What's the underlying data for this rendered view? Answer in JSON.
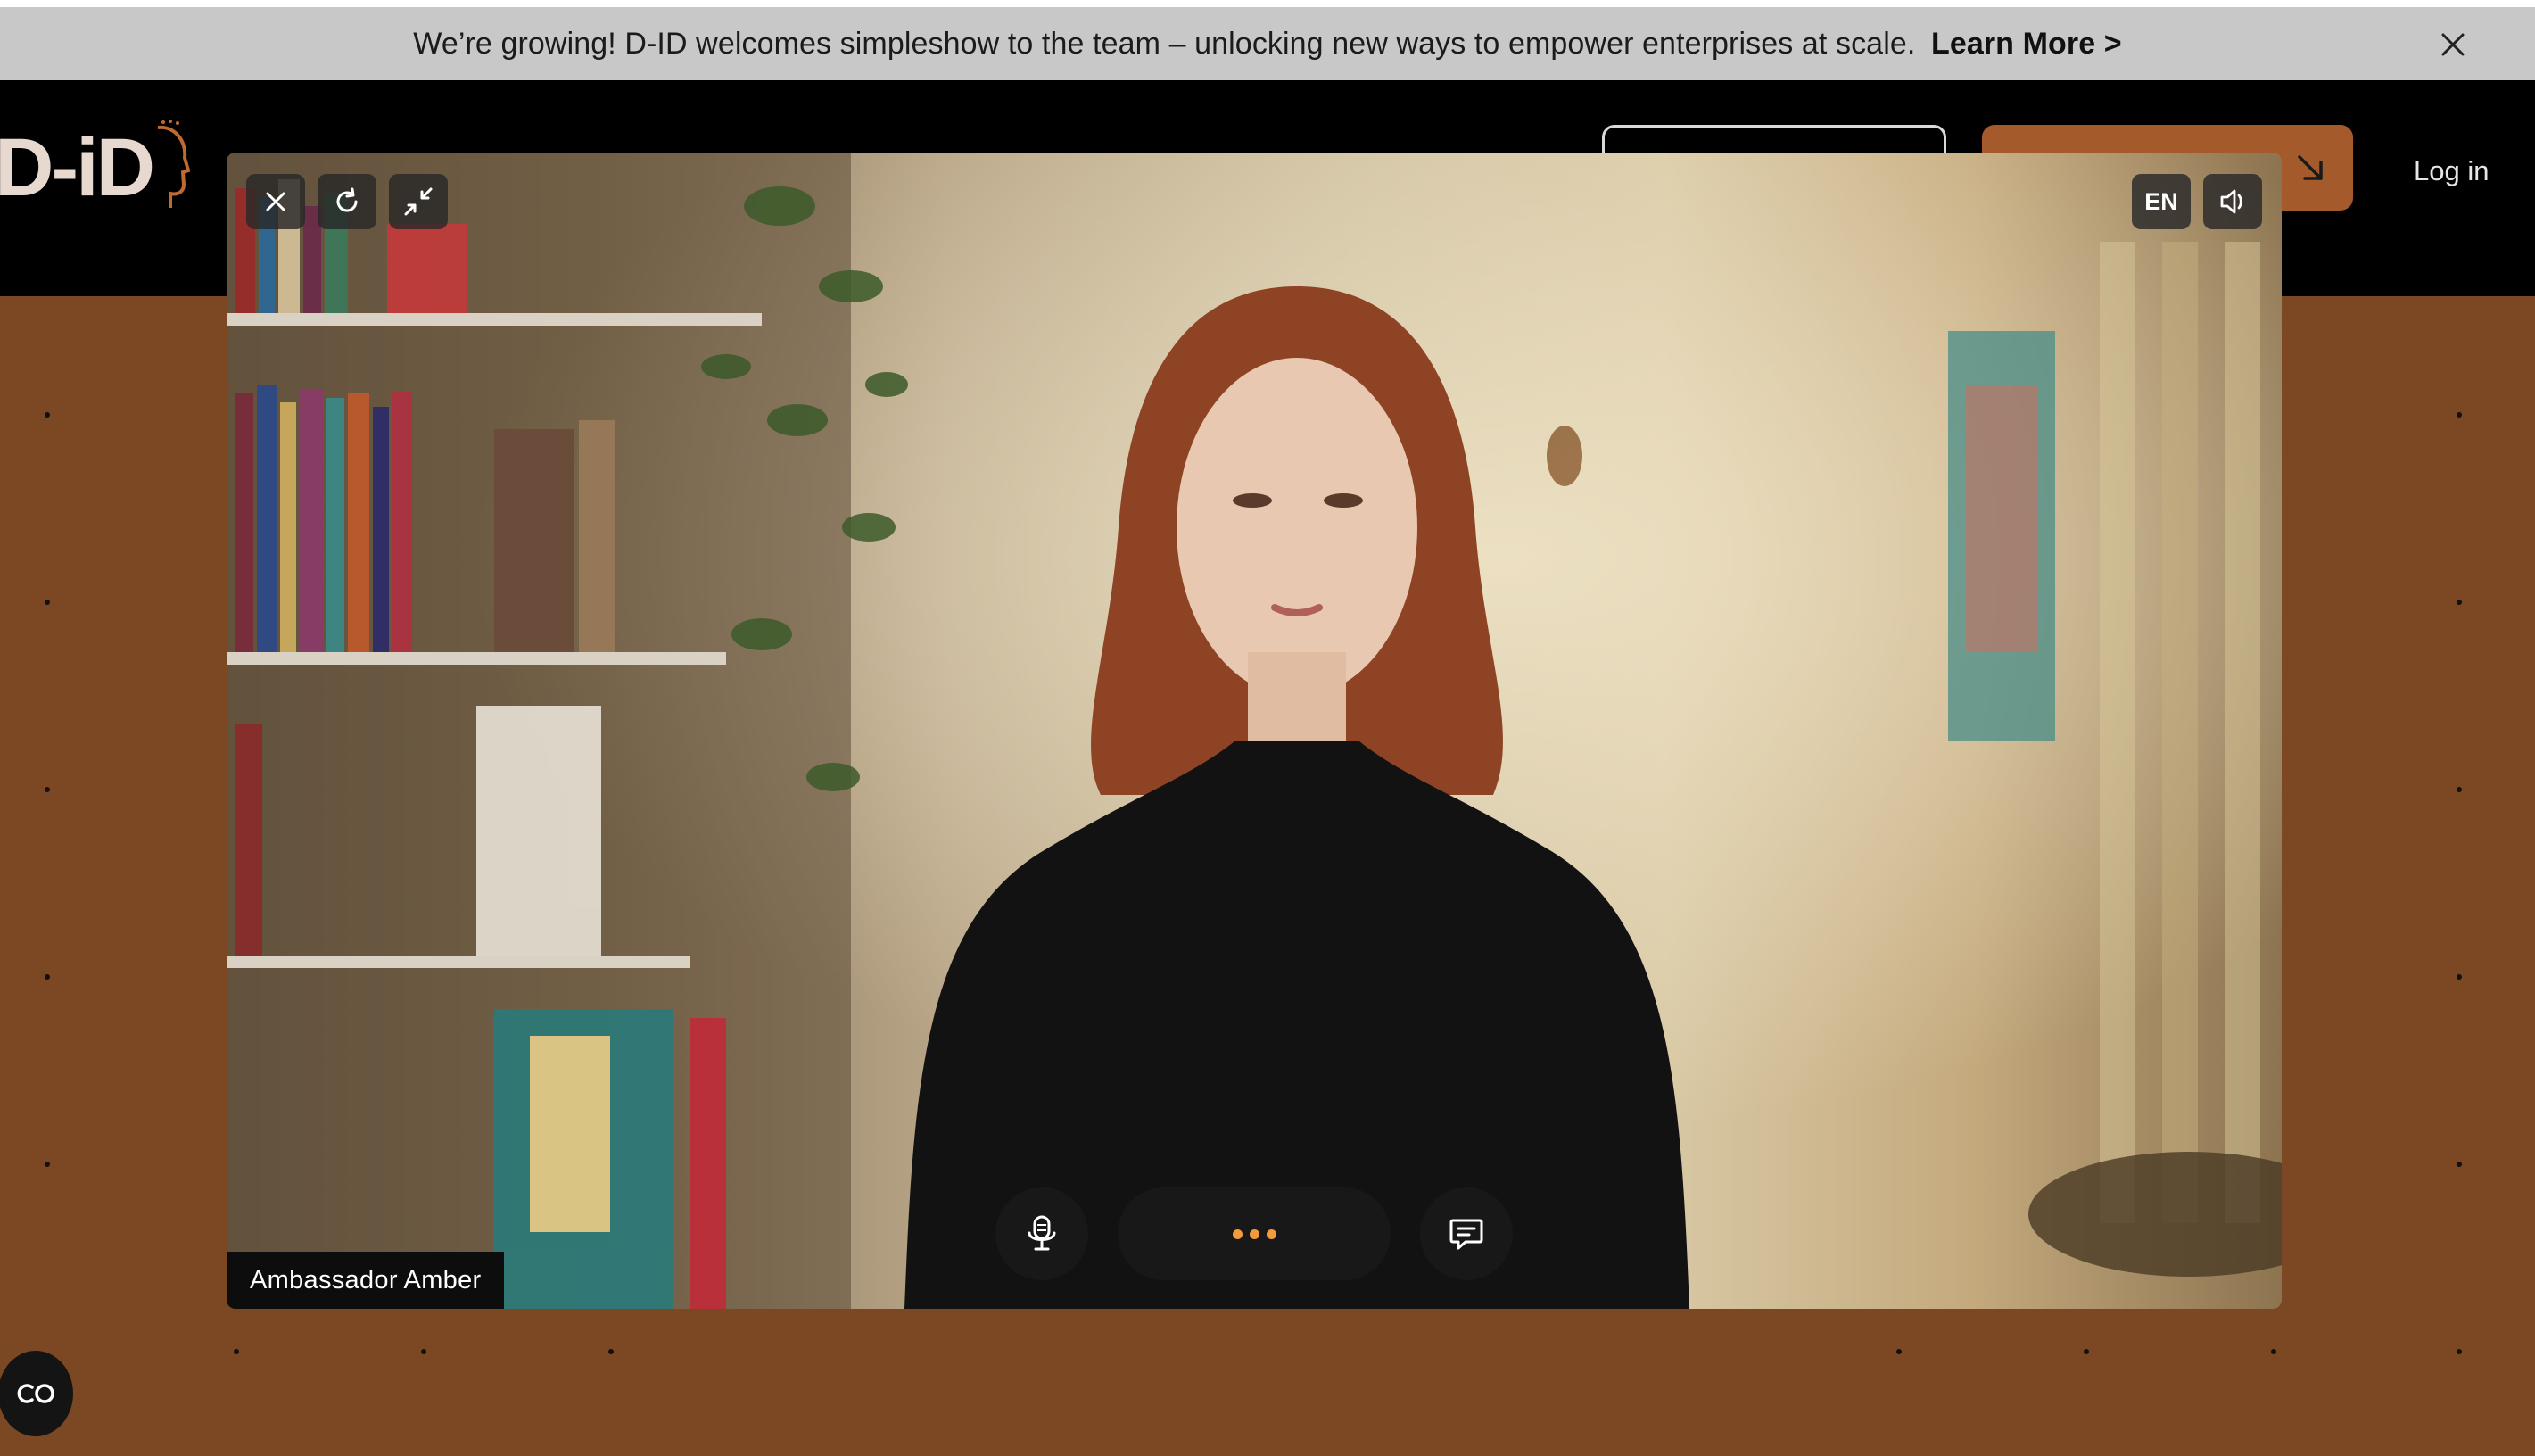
{
  "banner": {
    "message": "We’re growing! D-ID welcomes simpleshow to the team –  unlocking new ways to empower enterprises at scale.",
    "link_label": "Learn More >"
  },
  "header": {
    "logo_text": "D-iD",
    "login_label": "Log in"
  },
  "player": {
    "close_icon": "close-icon",
    "restart_icon": "refresh-icon",
    "minimize_icon": "minimize-icon",
    "language_label": "EN",
    "sound_icon": "speaker-icon",
    "mic_icon": "microphone-icon",
    "chat_icon": "chat-bubble-icon",
    "status": "typing-dots",
    "agent_name": "Ambassador Amber"
  },
  "captions_icon": "cc-icon",
  "colors": {
    "background": "#7c4723",
    "banner": "#c8c8c8",
    "header": "#000000",
    "cta": "#a45a2a",
    "accent_dots": "#f29b3a"
  }
}
